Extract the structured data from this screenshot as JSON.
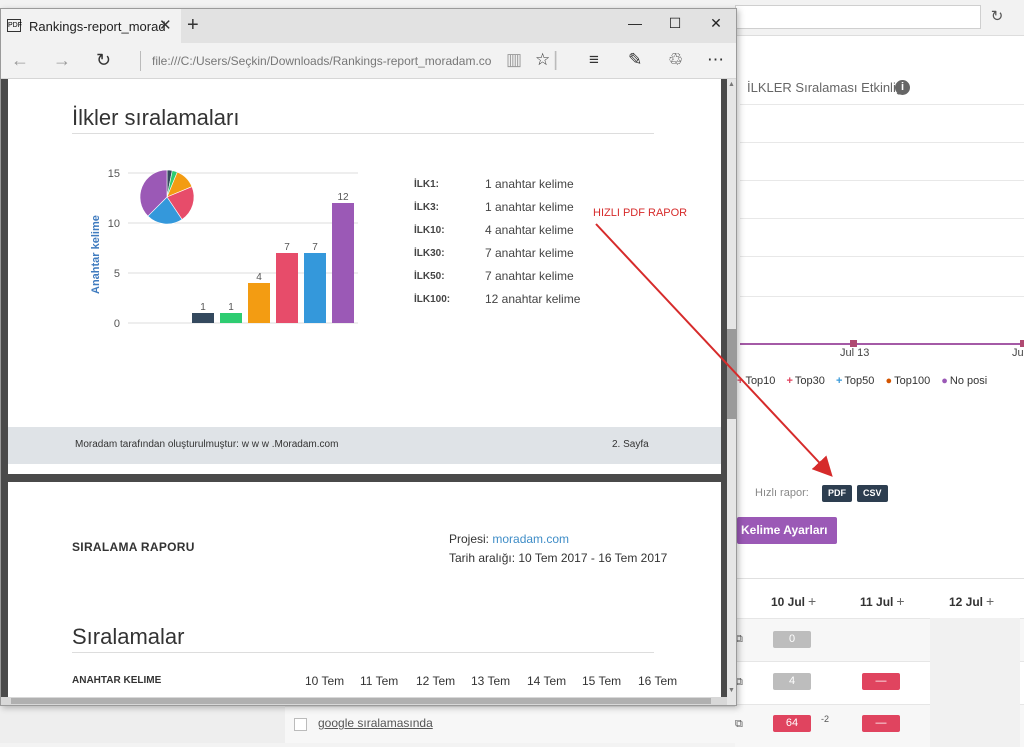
{
  "background_app": {
    "activity_title": "İLKLER Sıralaması Etkinliği",
    "info_icon": "i",
    "x_ticks": [
      "Jul 13",
      "Jul"
    ],
    "legend": [
      {
        "label": "Top10",
        "color": "#e0445f"
      },
      {
        "label": "Top30",
        "color": "#e0445f"
      },
      {
        "label": "Top50",
        "color": "#3a9ad9"
      },
      {
        "label": "Top100",
        "color": "#d35400"
      },
      {
        "label": "No posi",
        "color": "#9b59b6"
      }
    ],
    "quick_report_label": "Hızlı rapor:",
    "pdf_button": "PDF",
    "csv_button": "CSV",
    "keyword_settings_button": "Kelime Ayarları",
    "table_headers": [
      "10 Jul",
      "11 Jul",
      "12 Jul"
    ],
    "rows": [
      {
        "c1": "0",
        "c1_type": "gray",
        "c2": "",
        "c2_type": ""
      },
      {
        "c1": "4",
        "c1_type": "gray",
        "c2": "—",
        "c2_type": "red"
      },
      {
        "c1": "64",
        "c1_type": "red",
        "delta": "-2",
        "c2": "—",
        "c2_type": "red"
      }
    ],
    "keyword_link": "google sıralamasında"
  },
  "annotation": {
    "text": "HIZLI PDF RAPOR"
  },
  "browser": {
    "tab_title": "Rankings-report_morad",
    "tab_icon": "PDF",
    "url": "file:///C:/Users/Seçkin/Downloads/Rankings-report_moradam.com"
  },
  "page1": {
    "title": "İlkler sıralamaları",
    "ylabel": "Anahtar kelime",
    "stats": [
      {
        "key": "İLK1:",
        "value": "1 anahtar kelime"
      },
      {
        "key": "İLK3:",
        "value": "1 anahtar kelime"
      },
      {
        "key": "İLK10:",
        "value": "4 anahtar kelime"
      },
      {
        "key": "İLK30:",
        "value": "7 anahtar kelime"
      },
      {
        "key": "İLK50:",
        "value": "7 anahtar kelime"
      },
      {
        "key": "İLK100:",
        "value": "12 anahtar kelime"
      }
    ],
    "footer_left": "Moradam tarafından oluşturulmuştur: w w w .Moradam.com",
    "footer_right": "2. Sayfa"
  },
  "page2": {
    "report_title": "SIRALAMA RAPORU",
    "project_label": "Projesi:",
    "project_value": "moradam.com",
    "range": "Tarih aralığı: 10 Tem 2017 - 16 Tem 2017",
    "section_title": "Sıralamalar",
    "keyword_col": "ANAHTAR KELIME",
    "date_cols": [
      "10 Tem",
      "11 Tem",
      "12 Tem",
      "13 Tem",
      "14 Tem",
      "15 Tem",
      "16 Tem"
    ]
  },
  "chart_data": {
    "type": "bar",
    "categories": [
      "İLK1",
      "İLK3",
      "İLK10",
      "İLK30",
      "İLK50",
      "İLK100"
    ],
    "values": [
      1,
      1,
      4,
      7,
      7,
      12
    ],
    "colors": [
      "#34495e",
      "#2ecc71",
      "#f39c12",
      "#e74c6a",
      "#3498db",
      "#9b59b6"
    ],
    "ylabel": "Anahtar kelime",
    "ylim": [
      0,
      15
    ],
    "yticks": [
      0,
      5,
      10,
      15
    ],
    "grid": true,
    "inset_pie": {
      "values": [
        1,
        1,
        4,
        7,
        7,
        12
      ],
      "colors": [
        "#34495e",
        "#2ecc71",
        "#f39c12",
        "#e74c6a",
        "#3498db",
        "#9b59b6"
      ]
    }
  }
}
